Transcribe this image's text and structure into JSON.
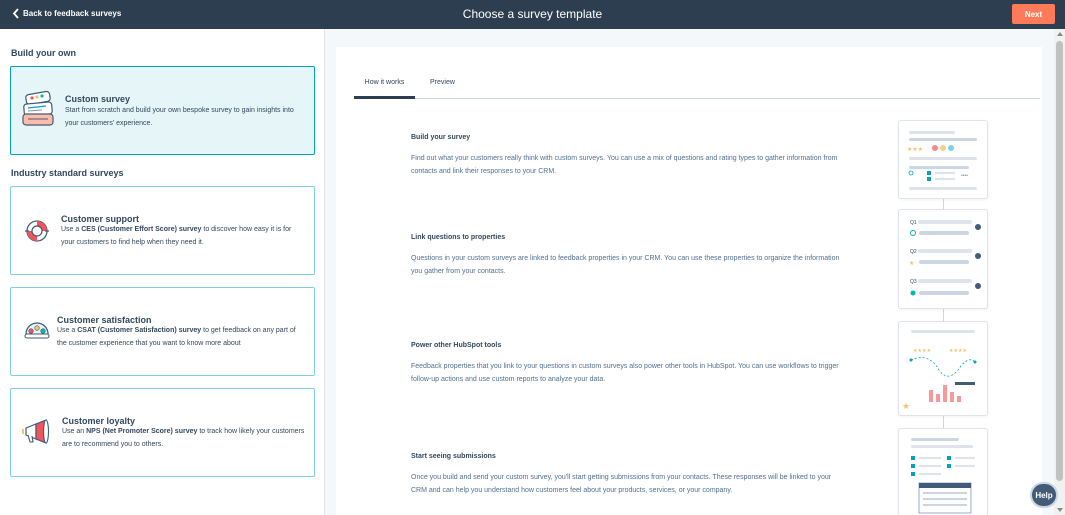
{
  "header": {
    "back_label": "Back to feedback surveys",
    "title": "Choose a survey template",
    "next_label": "Next"
  },
  "left": {
    "build_heading": "Build your own",
    "industry_heading": "Industry standard surveys",
    "custom": {
      "title": "Custom survey",
      "desc": "Start from scratch and build your own bespoke survey to gain insights into your customers' experience."
    },
    "support": {
      "title": "Customer support",
      "desc_pre": "Use a ",
      "desc_bold": "CES (Customer Effort Score) survey",
      "desc_post": " to discover how easy it is for your customers to find help when they need it."
    },
    "satisfaction": {
      "title": "Customer satisfaction",
      "desc_pre": "Use a ",
      "desc_bold": "CSAT (Customer Satisfaction) survey",
      "desc_post": " to get feedback on any part of the customer experience that you want to know more about"
    },
    "loyalty": {
      "title": "Customer loyalty",
      "desc_pre": "Use an ",
      "desc_bold": "NPS (Net Promoter Score) survey",
      "desc_post": " to track how likely your customers are to recommend you to others."
    }
  },
  "right": {
    "tabs": [
      "How it works",
      "Preview"
    ],
    "steps": [
      {
        "title": "Build your survey",
        "desc": "Find out what your customers really think with custom surveys. You can use a mix of questions and rating types to gather information from contacts and link their responses to your CRM."
      },
      {
        "title": "Link questions to properties",
        "desc": "Questions in your custom surveys are linked to feedback properties in your CRM. You can use these properties to organize the information you gather from your contacts."
      },
      {
        "title": "Power other HubSpot tools",
        "desc": "Feedback properties that you link to your questions in custom surveys also power other tools in HubSpot. You can use workflows to trigger follow-up actions and use custom reports to analyze your data."
      },
      {
        "title": "Start seeing submissions",
        "desc": "Once you build and send your custom survey, you'll start getting submissions from your contacts. These responses will be linked to your CRM and can help you understand how customers feel about your products, services, or your company."
      }
    ],
    "illustration2_labels": [
      "Q1",
      "Q2",
      "Q3"
    ]
  },
  "help_label": "Help",
  "colors": {
    "header_bg": "#2d3e50",
    "accent_orange": "#ff7a59",
    "selected_border": "#00a4bd",
    "selected_bg": "#e5f5f8"
  },
  "icons": [
    "chevron-left-icon",
    "survey-stack-icon",
    "life-ring-icon",
    "emoji-rating-icon",
    "megaphone-icon"
  ]
}
